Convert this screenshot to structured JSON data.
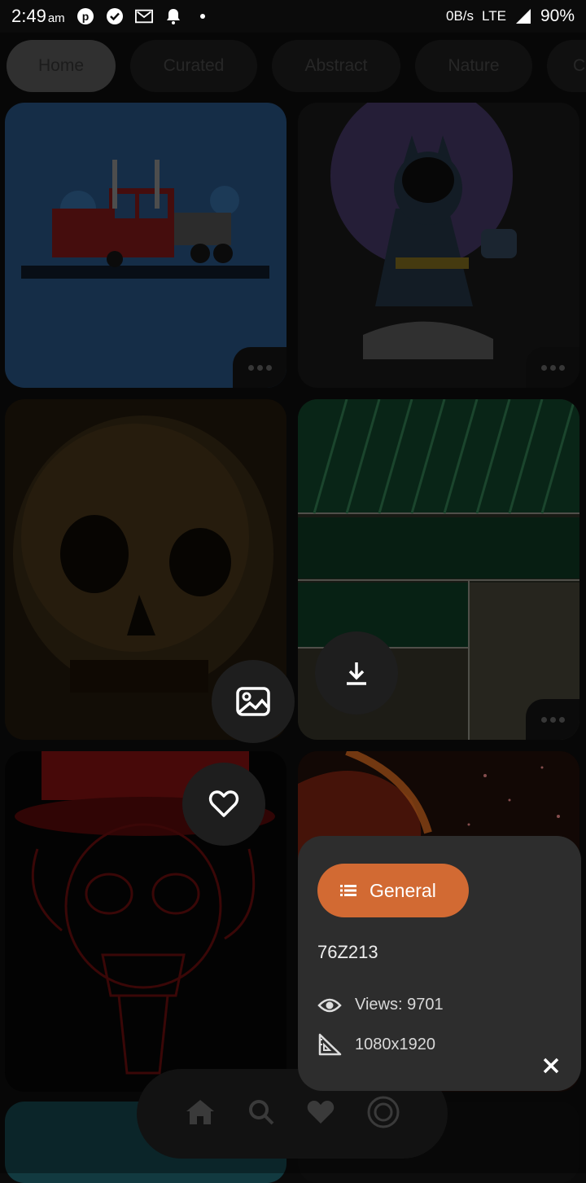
{
  "status_bar": {
    "time": "2:49",
    "ampm": "am",
    "network_speed": "0B/s",
    "network_type": "LTE",
    "battery": "90%"
  },
  "chips": [
    {
      "label": "Home"
    },
    {
      "label": "Curated"
    },
    {
      "label": "Abstract"
    },
    {
      "label": "Nature"
    },
    {
      "label": "C"
    }
  ],
  "info_panel": {
    "category": "General",
    "id": "76Z213",
    "views": "Views: 9701",
    "resolution": "1080x1920"
  },
  "colors": {
    "accent": "#d26a33",
    "panel": "#2d2d2d"
  }
}
